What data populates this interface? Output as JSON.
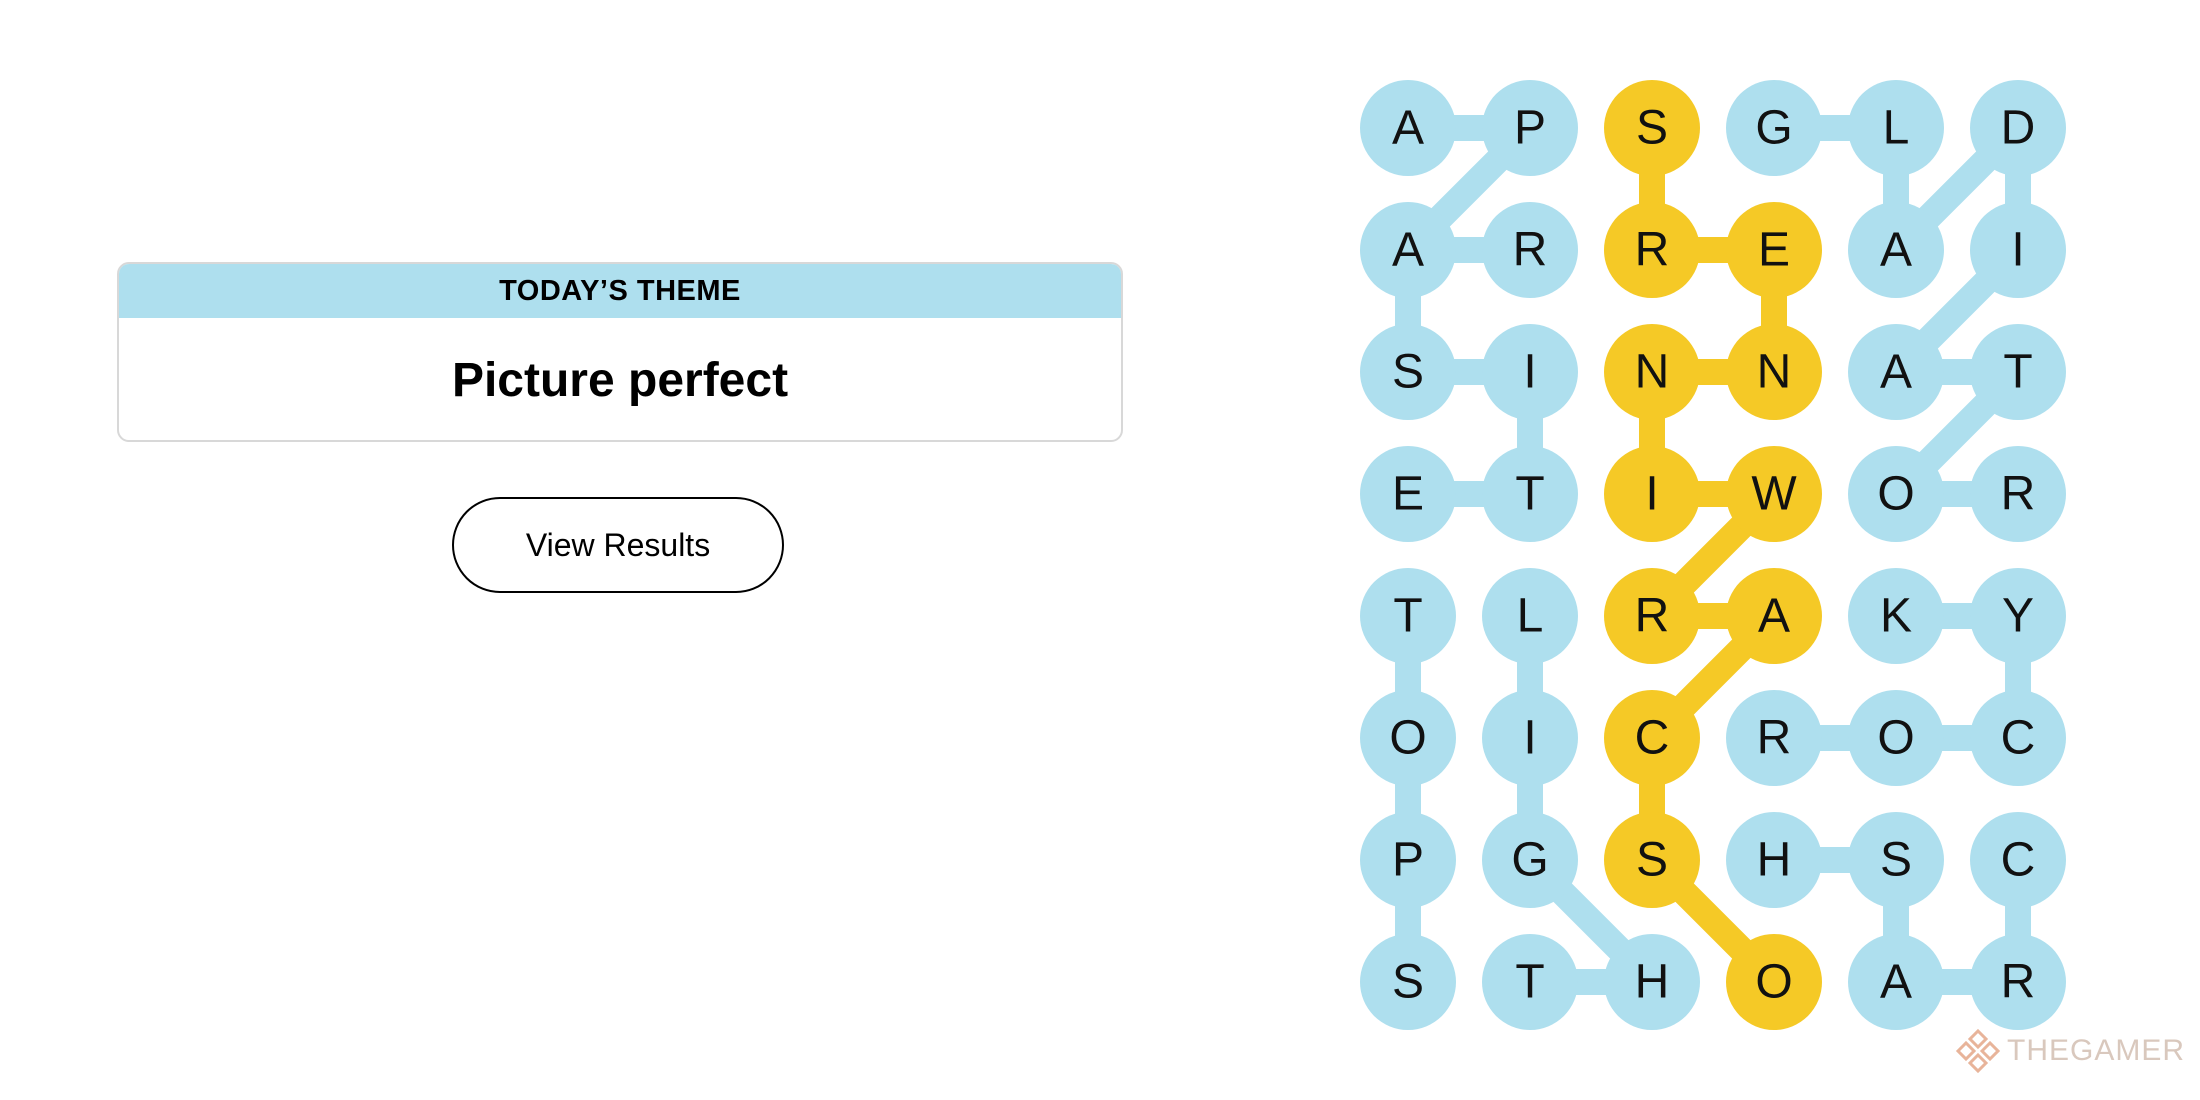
{
  "theme": {
    "header": "TODAY’S THEME",
    "title": "Picture perfect"
  },
  "actions": {
    "view_results": "View Results"
  },
  "board": {
    "rows": 8,
    "cols": 6,
    "letters": [
      [
        "A",
        "P",
        "S",
        "G",
        "L",
        "D"
      ],
      [
        "A",
        "R",
        "R",
        "E",
        "A",
        "I"
      ],
      [
        "S",
        "I",
        "N",
        "N",
        "A",
        "T"
      ],
      [
        "E",
        "T",
        "I",
        "W",
        "O",
        "R"
      ],
      [
        "T",
        "L",
        "R",
        "A",
        "K",
        "Y"
      ],
      [
        "O",
        "I",
        "C",
        "R",
        "O",
        "C"
      ],
      [
        "P",
        "G",
        "S",
        "H",
        "S",
        "C"
      ],
      [
        "S",
        "T",
        "H",
        "O",
        "A",
        "R"
      ]
    ],
    "colors": {
      "theme_word": "#aedfee",
      "spangram": "#f5c926",
      "text": "#111111"
    },
    "words": [
      {
        "kind": "spangram",
        "path": [
          [
            0,
            2
          ],
          [
            1,
            2
          ],
          [
            1,
            3
          ],
          [
            2,
            3
          ],
          [
            2,
            2
          ],
          [
            3,
            2
          ],
          [
            3,
            3
          ],
          [
            4,
            2
          ],
          [
            4,
            3
          ],
          [
            5,
            2
          ],
          [
            6,
            2
          ],
          [
            7,
            3
          ]
        ]
      },
      {
        "kind": "theme_word",
        "path": [
          [
            0,
            0
          ],
          [
            0,
            1
          ],
          [
            1,
            0
          ],
          [
            1,
            1
          ]
        ]
      },
      {
        "kind": "theme_word",
        "path": [
          [
            1,
            0
          ],
          [
            2,
            0
          ],
          [
            2,
            1
          ],
          [
            3,
            1
          ],
          [
            3,
            0
          ]
        ]
      },
      {
        "kind": "theme_word",
        "path": [
          [
            4,
            0
          ],
          [
            5,
            0
          ],
          [
            6,
            0
          ],
          [
            7,
            0
          ]
        ]
      },
      {
        "kind": "theme_word",
        "path": [
          [
            4,
            1
          ],
          [
            5,
            1
          ],
          [
            6,
            1
          ],
          [
            7,
            2
          ],
          [
            7,
            1
          ]
        ]
      },
      {
        "kind": "theme_word",
        "path": [
          [
            0,
            3
          ],
          [
            0,
            4
          ],
          [
            1,
            4
          ],
          [
            0,
            5
          ],
          [
            1,
            5
          ],
          [
            2,
            4
          ],
          [
            2,
            5
          ],
          [
            3,
            4
          ],
          [
            3,
            5
          ]
        ]
      },
      {
        "kind": "theme_word",
        "path": [
          [
            4,
            4
          ],
          [
            4,
            5
          ],
          [
            5,
            5
          ],
          [
            5,
            4
          ],
          [
            5,
            3
          ]
        ]
      },
      {
        "kind": "theme_word",
        "path": [
          [
            6,
            3
          ],
          [
            6,
            4
          ],
          [
            7,
            4
          ],
          [
            7,
            5
          ],
          [
            6,
            5
          ]
        ]
      }
    ]
  },
  "watermark": {
    "text": "THEGAMER",
    "icon": "thegamer-logo-icon",
    "color": "#d9c8bd"
  }
}
